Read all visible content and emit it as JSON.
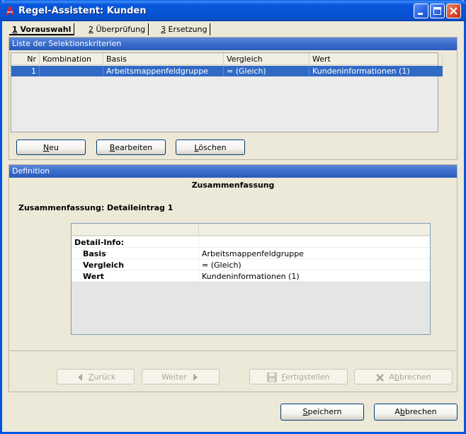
{
  "window": {
    "title": "Regel-Assistent: Kunden"
  },
  "tabs": [
    {
      "num": "1",
      "label": " Vorauswahl"
    },
    {
      "num": "2",
      "label": " Überprüfung"
    },
    {
      "num": "3",
      "label": " Ersetzung"
    }
  ],
  "criteria": {
    "header": "Liste der Selektionskriterien",
    "columns": [
      "Nr",
      "Kombination",
      "Basis",
      "Vergleich",
      "Wert"
    ],
    "rows": [
      {
        "nr": "1",
        "kombination": "",
        "basis": "Arbeitsmappenfeldgruppe",
        "vergleich": "= (Gleich)",
        "wert": "Kundeninformationen (1)"
      }
    ],
    "buttons": {
      "new": {
        "u": "N",
        "rest": "eu"
      },
      "edit": {
        "u": "B",
        "rest": "earbeiten"
      },
      "delete": {
        "u": "L",
        "rest": "öschen"
      }
    }
  },
  "definition": {
    "header": "Definition",
    "title": "Zusammenfassung",
    "subtitle": "Zusammenfassung: Detaileintrag 1",
    "detail_group": "Detail-Info:",
    "details": [
      {
        "key": "Basis",
        "value": "Arbeitsmappenfeldgruppe"
      },
      {
        "key": "Vergleich",
        "value": "= (Gleich)"
      },
      {
        "key": "Wert",
        "value": "Kundeninformationen (1)"
      }
    ]
  },
  "wizard_buttons": {
    "back": {
      "u": "Z",
      "rest": "urück"
    },
    "next": "Weiter",
    "finish": {
      "u": "F",
      "rest": "ertigstellen"
    },
    "cancel": {
      "pre": "A",
      "u": "b",
      "rest": "brechen"
    }
  },
  "footer_buttons": {
    "save": {
      "u": "S",
      "rest": "peichern"
    },
    "cancel": {
      "pre": "A",
      "u": "b",
      "rest": "brechen"
    }
  },
  "colors": {
    "titlebar": "#0A58DC",
    "header_bar": "#3A6CCB",
    "selection": "#316AC5",
    "dialog_bg": "#ECE9D8"
  }
}
